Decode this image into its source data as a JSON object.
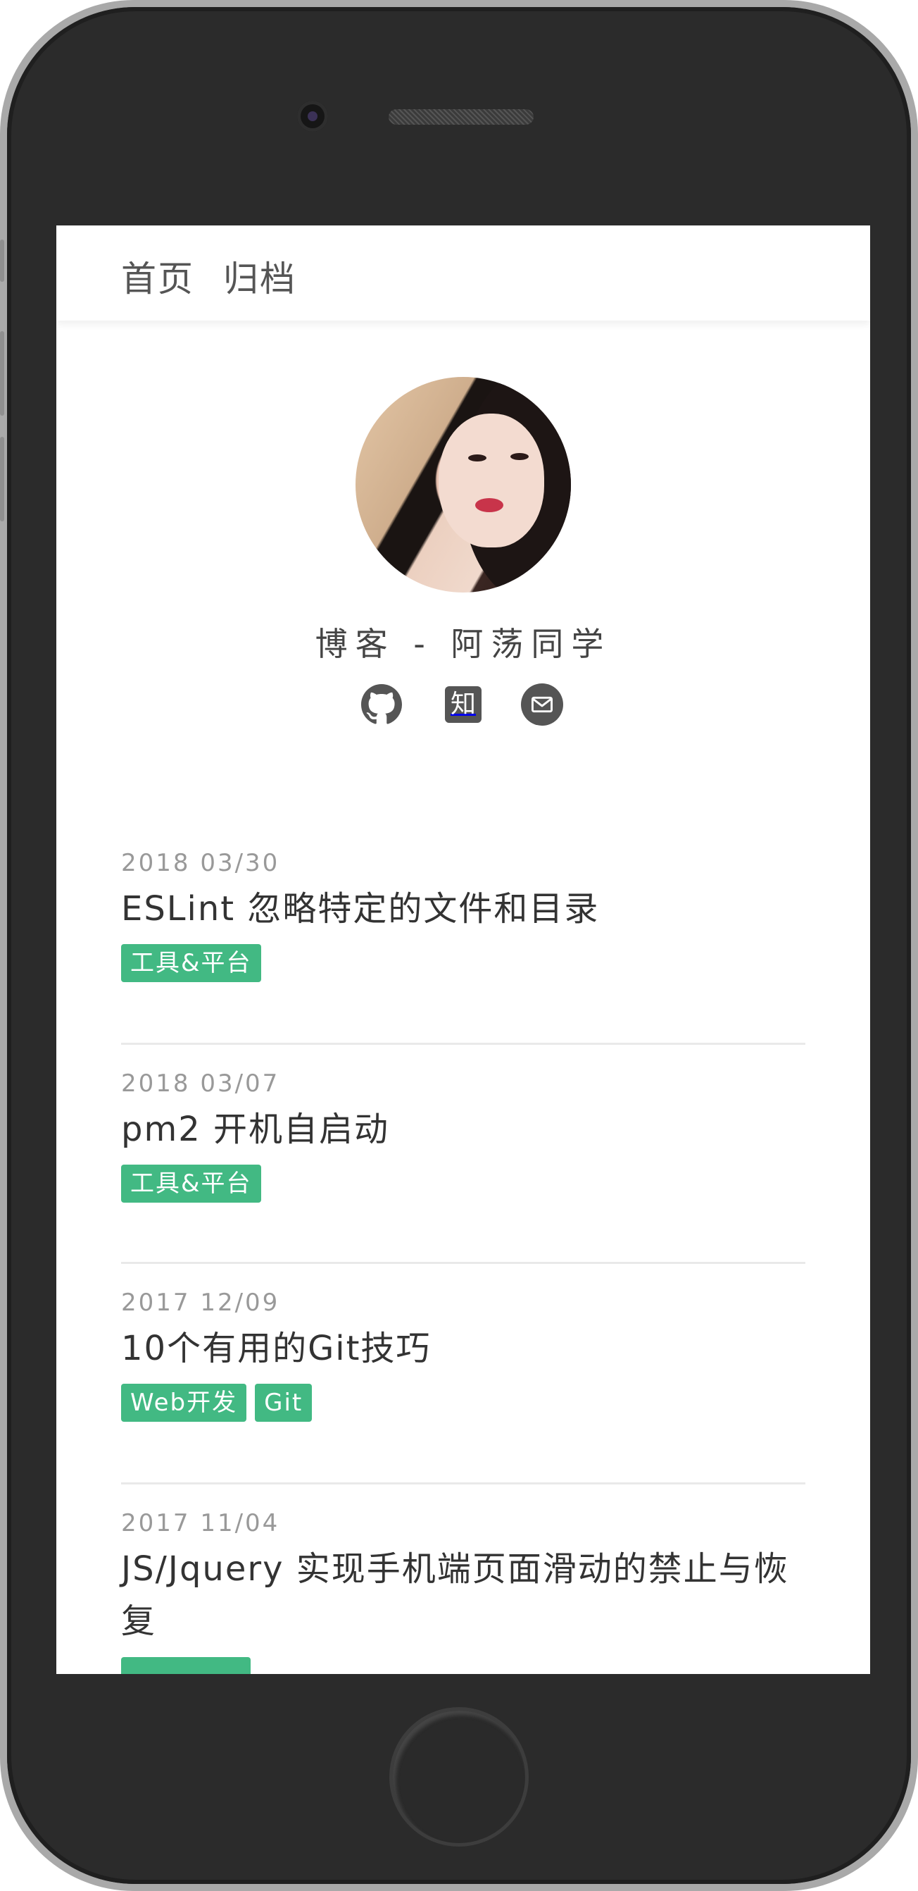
{
  "nav": {
    "items": [
      {
        "label": "首页"
      },
      {
        "label": "归档"
      }
    ]
  },
  "profile": {
    "title": "博客 - 阿荡同学",
    "social": [
      {
        "icon": "github-icon"
      },
      {
        "icon": "zhihu-icon",
        "glyph": "知"
      },
      {
        "icon": "mail-icon"
      }
    ]
  },
  "posts": [
    {
      "date": "2018 03/30",
      "title": "ESLint 忽略特定的文件和目录",
      "tags": [
        "工具&平台"
      ]
    },
    {
      "date": "2018 03/07",
      "title": "pm2 开机自启动",
      "tags": [
        "工具&平台"
      ]
    },
    {
      "date": "2017 12/09",
      "title": "10个有用的Git技巧",
      "tags": [
        "Web开发",
        "Git"
      ]
    },
    {
      "date": "2017 11/04",
      "title": "JS/Jquery 实现手机端页面滑动的禁止与恢复",
      "tags": [
        ""
      ]
    }
  ],
  "colors": {
    "tag_bg": "#42b983",
    "phone_body": "#2b2b2b",
    "phone_rim": "#a9a9a9"
  }
}
